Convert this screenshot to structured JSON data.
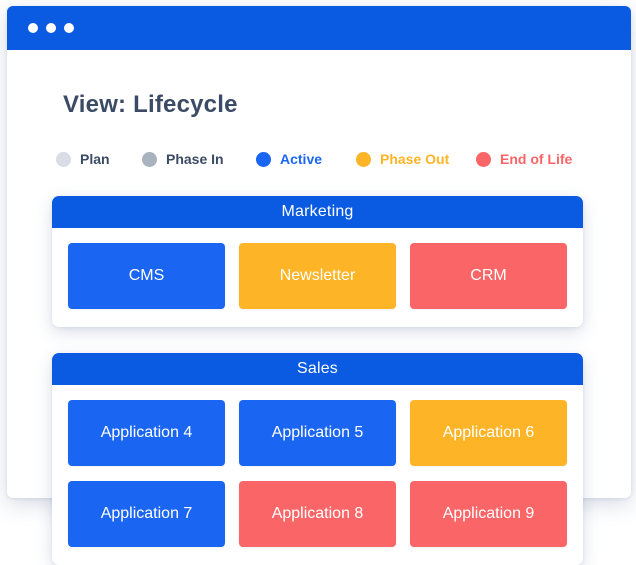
{
  "window": {
    "controls": [
      "dot",
      "dot",
      "dot"
    ]
  },
  "view": {
    "title": "View: Lifecycle"
  },
  "colors": {
    "plan": "#d8dde6",
    "phase_in": "#a9b2bf",
    "active": "#1a66f2",
    "phase_out": "#feb427",
    "end_of_life": "#fa6567",
    "header": "#0a5ae2",
    "title_text": "#3b4b66"
  },
  "legend": [
    {
      "key": "plan",
      "label": "Plan",
      "dot_color": "#d8dde6",
      "text_color": "#3b4b66"
    },
    {
      "key": "phase_in",
      "label": "Phase In",
      "dot_color": "#a9b2bf",
      "text_color": "#3b4b66"
    },
    {
      "key": "active",
      "label": "Active",
      "dot_color": "#1a66f2",
      "text_color": "#1a66f2"
    },
    {
      "key": "phase_out",
      "label": "Phase Out",
      "dot_color": "#feb427",
      "text_color": "#feb427"
    },
    {
      "key": "end_of_life",
      "label": "End of Life",
      "dot_color": "#fa6567",
      "text_color": "#fa6567"
    }
  ],
  "groups": [
    {
      "name": "Marketing",
      "apps": [
        {
          "label": "CMS",
          "status": "Active"
        },
        {
          "label": "Newsletter",
          "status": "Phase Out"
        },
        {
          "label": "CRM",
          "status": "End of Life"
        }
      ]
    },
    {
      "name": "Sales",
      "apps": [
        {
          "label": "Application 4",
          "status": "Active"
        },
        {
          "label": "Application 5",
          "status": "Active"
        },
        {
          "label": "Application 6",
          "status": "Phase Out"
        },
        {
          "label": "Application 7",
          "status": "Active"
        },
        {
          "label": "Application 8",
          "status": "End of Life"
        },
        {
          "label": "Application 9",
          "status": "End of Life"
        }
      ]
    }
  ]
}
